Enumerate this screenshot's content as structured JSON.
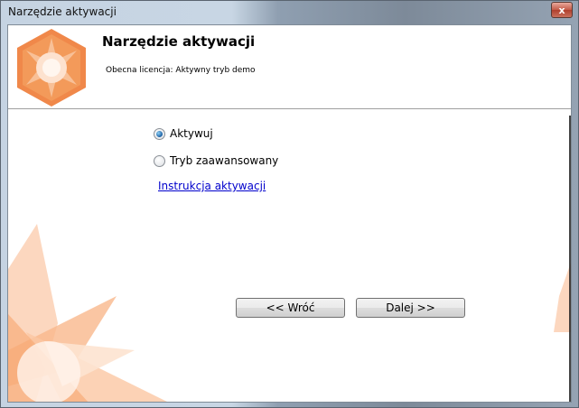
{
  "window": {
    "title": "Narzędzie aktywacji",
    "close_glyph": "x"
  },
  "header": {
    "title": "Narzędzie aktywacji",
    "subtitle": "Obecna licencja: Aktywny tryb demo",
    "logo_icon": "orange-hexagon-star-icon"
  },
  "options": {
    "activate_label": "Aktywuj",
    "activate_checked": true,
    "advanced_label": "Tryb zaawansowany",
    "advanced_checked": false
  },
  "link": {
    "label": "Instrukcja aktywacji"
  },
  "buttons": {
    "back_label": "<< Wróć",
    "next_label": "Dalej >>"
  },
  "colors": {
    "accent_orange": "#f39a5a",
    "link_blue": "#0000cc",
    "close_red": "#c45a47"
  }
}
